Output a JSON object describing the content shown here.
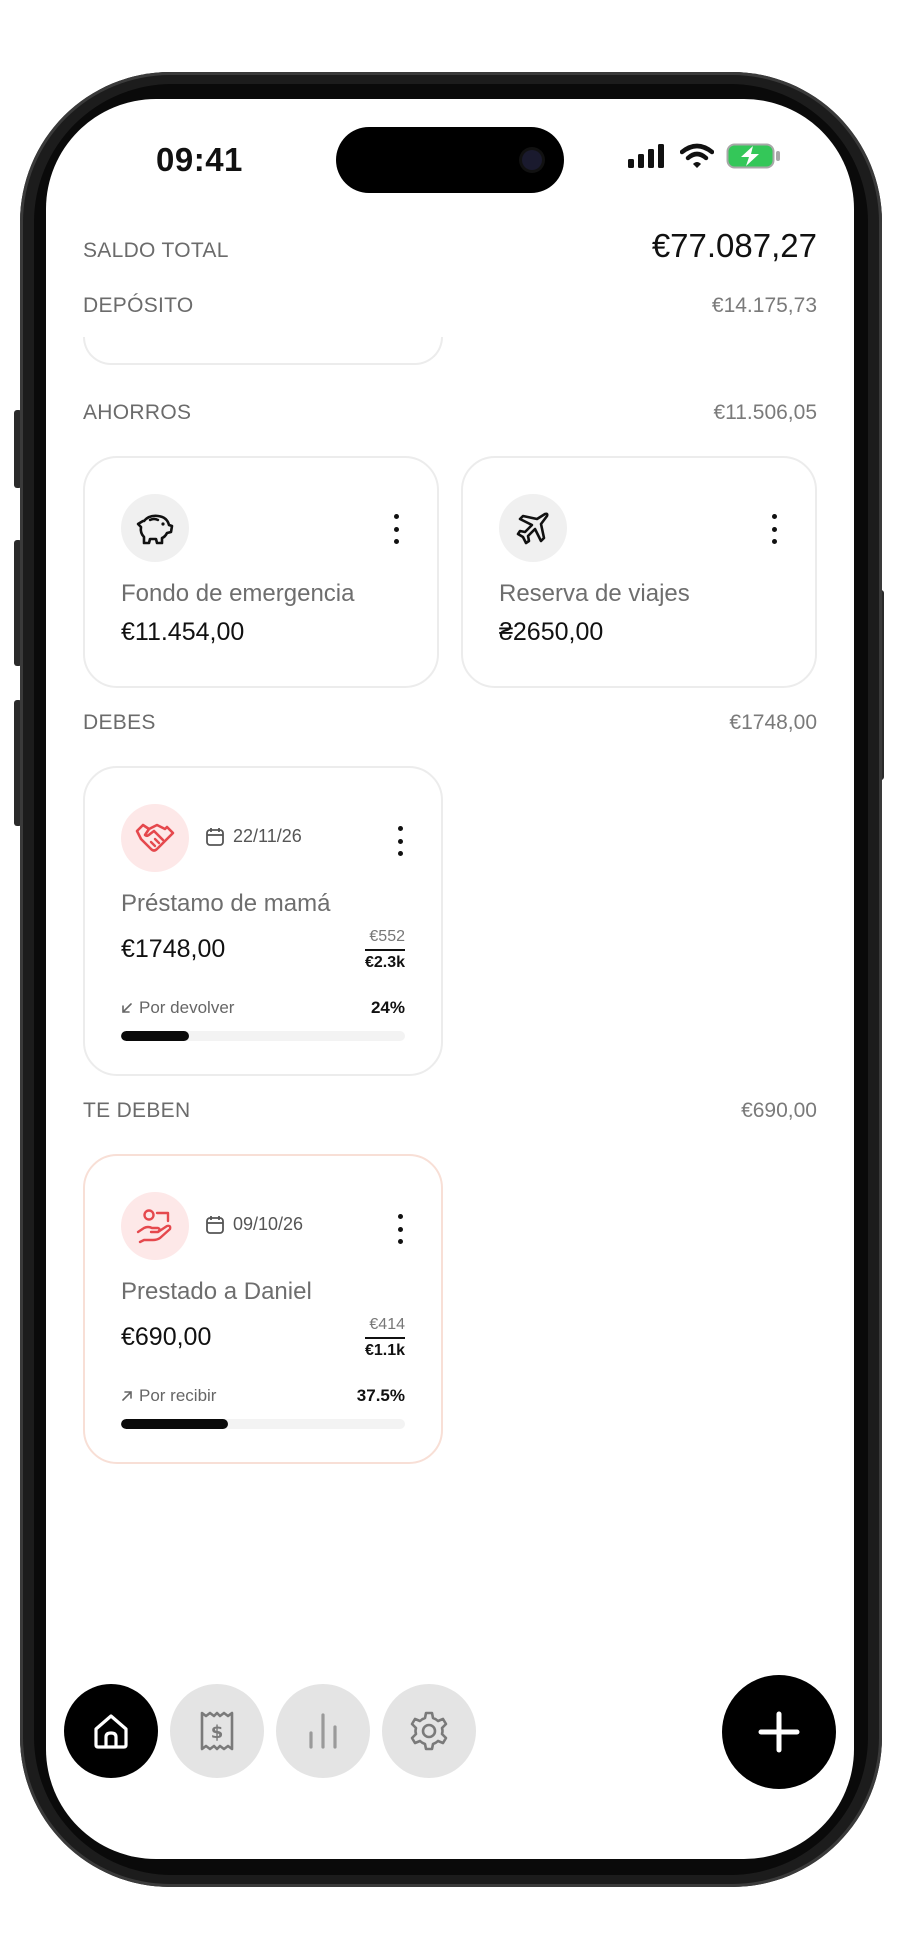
{
  "status_bar": {
    "time": "09:41"
  },
  "summary": {
    "label": "SALDO TOTAL",
    "amount": "€77.087,27"
  },
  "sections": {
    "deposito": {
      "label": "DEPÓSITO",
      "amount": "€14.175,73"
    },
    "ahorros": {
      "label": "AHORROS",
      "amount": "€11.506,05"
    },
    "debes": {
      "label": "DEBES",
      "amount": "€1748,00"
    },
    "te_deben": {
      "label": "TE DEBEN",
      "amount": "€690,00"
    }
  },
  "savings": [
    {
      "icon": "piggy-bank-icon",
      "title": "Fondo de emergencia",
      "amount": "€11.454,00"
    },
    {
      "icon": "airplane-icon",
      "title": "Reserva de viajes",
      "amount": "₴2650,00"
    }
  ],
  "debts": [
    {
      "icon": "handshake-icon",
      "date": "22/11/26",
      "title": "Préstamo de mamá",
      "amount": "€1748,00",
      "paid": "€552",
      "total": "€2.3k",
      "progress_label": "Por devolver",
      "progress_text": "24%",
      "progress_fraction": 0.24
    }
  ],
  "owed": [
    {
      "icon": "hand-giving-icon",
      "date": "09/10/26",
      "title": "Prestado a Daniel",
      "amount": "€690,00",
      "received": "€414",
      "total": "€1.1k",
      "progress_label": "Por recibir",
      "progress_text": "37.5%",
      "progress_fraction": 0.375
    }
  ],
  "nav": [
    {
      "icon": "home-icon",
      "active": true
    },
    {
      "icon": "receipt-icon",
      "active": false
    },
    {
      "icon": "chart-icon",
      "active": false
    },
    {
      "icon": "gear-icon",
      "active": false
    }
  ],
  "fab": {
    "icon": "plus-icon"
  },
  "colors": {
    "accent": "#000000",
    "debt_icon": "#e5484d",
    "owed_border": "#f8dfd6",
    "battery": "#34c759"
  }
}
